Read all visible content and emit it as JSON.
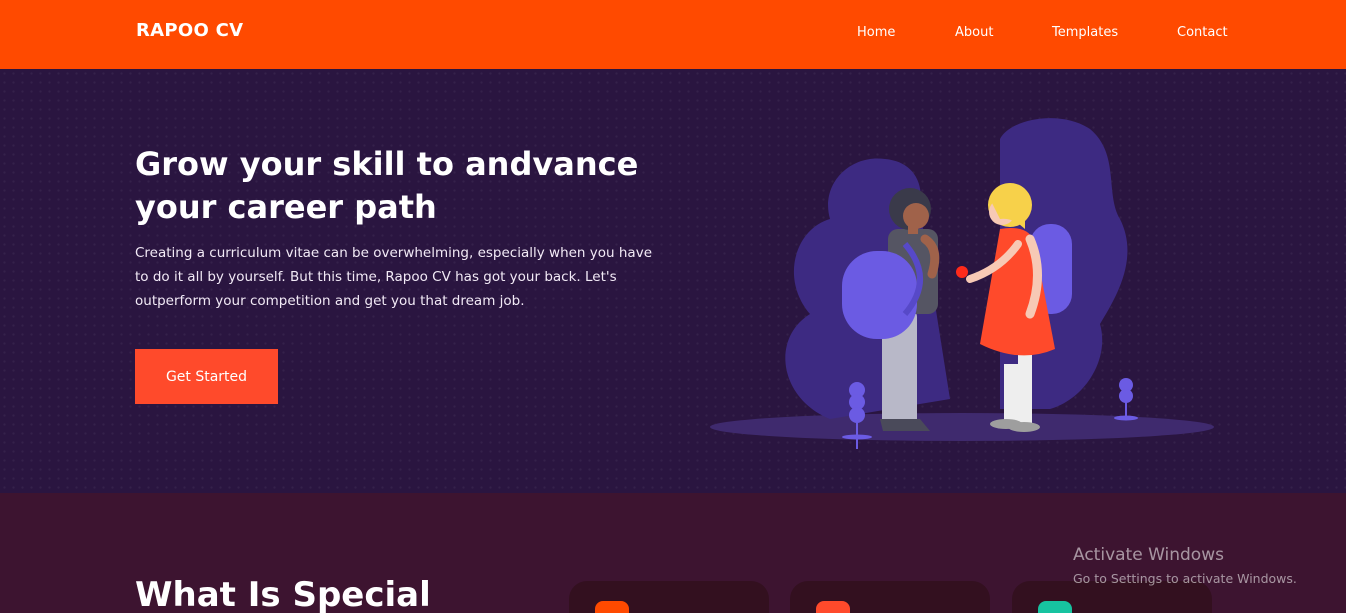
{
  "navbar": {
    "brand": "RAPOO CV",
    "links": [
      {
        "label": "Home"
      },
      {
        "label": "About"
      },
      {
        "label": "Templates"
      },
      {
        "label": "Contact"
      }
    ]
  },
  "hero": {
    "title": "Grow your skill to andvance your career path",
    "description": "Creating a curriculum vitae can be overwhelming, especially when you have to do it all by yourself. But this time, Rapoo CV has got your back. Let's outperform your competition and get you that dream job.",
    "cta_label": "Get Started"
  },
  "special": {
    "title": "What Is Special"
  },
  "watermark": {
    "title": "Activate Windows",
    "subtitle": "Go to Settings to activate Windows."
  },
  "colors": {
    "navbar": "#ff4a00",
    "hero_bg": "#2a1540",
    "cta": "#ff4a2b",
    "special_bg": "#3d1430",
    "card_icon_1": "#ff4a00",
    "card_icon_2": "#ff4a2b",
    "card_icon_3": "#17c3a0"
  }
}
